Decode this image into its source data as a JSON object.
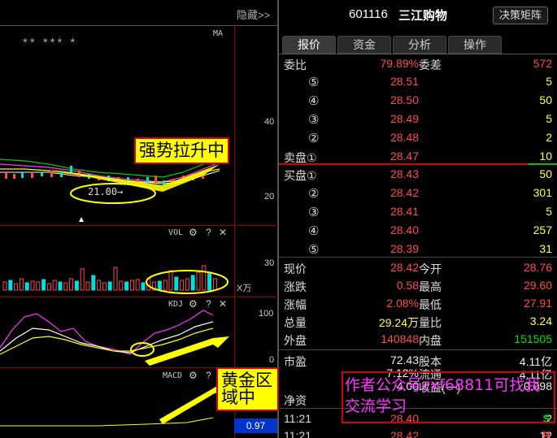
{
  "left": {
    "hide_label": "隐藏>>",
    "ma_label": "MA",
    "stars": "** *** *",
    "price_axis": [
      "40",
      "20"
    ],
    "price_marker": "21.00→",
    "callout_top": "强势拉升中",
    "vol": {
      "title": "VOL",
      "axis": "30",
      "unit": "X万"
    },
    "kdj": {
      "title": "KDJ",
      "axis": [
        "100",
        "0"
      ]
    },
    "macd": {
      "title": "MACD"
    },
    "callout_bottom": "黄金区域中",
    "gear_icon": "⚙",
    "help_icon": "?",
    "close_icon": "✕",
    "current_price_box": "0.97"
  },
  "header": {
    "code": "601116",
    "name": "三江购物",
    "decision_button": "决策矩阵"
  },
  "tabs": [
    "报价",
    "资金",
    "分析",
    "操作"
  ],
  "weibi": {
    "label": "委比",
    "value": "79.89%",
    "label2": "委差",
    "value2": "572"
  },
  "sell": [
    {
      "label": "⑤",
      "price": "28.51",
      "vol": "5"
    },
    {
      "label": "④",
      "price": "28.50",
      "vol": "50"
    },
    {
      "label": "③",
      "price": "28.49",
      "vol": "5"
    },
    {
      "label": "②",
      "price": "28.48",
      "vol": "2"
    },
    {
      "label": "卖盘①",
      "price": "28.47",
      "vol": "10"
    }
  ],
  "buy": [
    {
      "label": "买盘①",
      "price": "28.43",
      "vol": "50"
    },
    {
      "label": "②",
      "price": "28.42",
      "vol": "301"
    },
    {
      "label": "③",
      "price": "28.41",
      "vol": "5"
    },
    {
      "label": "④",
      "price": "28.40",
      "vol": "257"
    },
    {
      "label": "⑤",
      "price": "28.39",
      "vol": "31"
    }
  ],
  "stats": [
    {
      "l1": "现价",
      "v1": "28.42",
      "l2": "今开",
      "v2": "28.76"
    },
    {
      "l1": "涨跌",
      "v1": "0.58",
      "l2": "最高",
      "v2": "29.60"
    },
    {
      "l1": "涨幅",
      "v1": "2.08%",
      "l2": "最低",
      "v2": "27.91"
    },
    {
      "l1": "总量",
      "v1": "29.24万",
      "l2": "量比",
      "v2": "3.24"
    },
    {
      "l1": "外盘",
      "v1": "140848",
      "l2": "内盘",
      "v2": "151505"
    }
  ],
  "finance": [
    {
      "l1": "市盈",
      "v1": "72.43",
      "l2": "股本",
      "v2": "4.11亿"
    },
    {
      "l1": "",
      "v1": "7.12%",
      "l2": "流通",
      "v2": "4.11亿"
    },
    {
      "l1": "",
      "v1": "4.00",
      "l2": "收益(一)",
      "v2": "0.098"
    },
    {
      "l1": "净资",
      "v1": "",
      "l2": "",
      "v2": ""
    }
  ],
  "ticks": [
    {
      "time": "11:21",
      "price": "28.40",
      "vol": "2",
      "flag": "S"
    },
    {
      "time": "11:21",
      "price": "28.42",
      "vol": "12",
      "flag": "B"
    }
  ],
  "author_note": "作者公众号zxf68811可找我交流学习",
  "colors": {
    "up": "#ff4a4a",
    "down": "#00e000",
    "highlight": "#ffff00",
    "note": "#ff33ff"
  }
}
